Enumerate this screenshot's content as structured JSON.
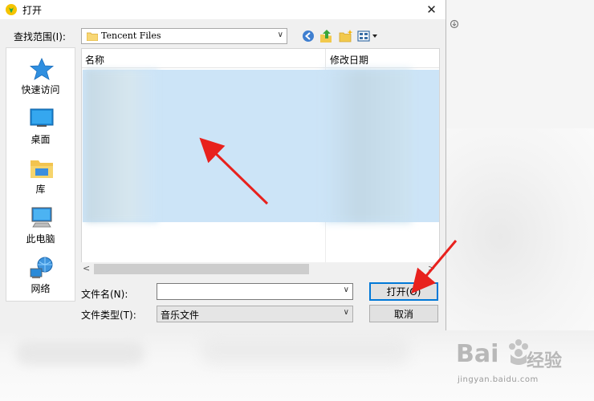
{
  "dialog": {
    "title": "打开",
    "close": "✕",
    "lookin_label": "查找范围(I):",
    "lookin_value": "Tencent Files",
    "icons": {
      "app": "app-logo-icon",
      "back": "back-icon",
      "up": "up-folder-icon",
      "new_folder": "new-folder-icon",
      "view": "view-menu-icon"
    }
  },
  "places": [
    {
      "label": "快速访问",
      "icon": "quick-access-icon"
    },
    {
      "label": "桌面",
      "icon": "desktop-icon"
    },
    {
      "label": "库",
      "icon": "library-icon"
    },
    {
      "label": "此电脑",
      "icon": "this-pc-icon"
    },
    {
      "label": "网络",
      "icon": "network-icon"
    }
  ],
  "filelist": {
    "col_name": "名称",
    "col_date": "修改日期"
  },
  "form": {
    "filename_label": "文件名(N):",
    "filename_value": "",
    "filetype_label": "文件类型(T):",
    "filetype_value": "音乐文件",
    "open_label": "打开(O)",
    "cancel_label": "取消"
  },
  "watermark": {
    "brand": "Bai",
    "brand_suffix": "经验",
    "url": "jingyan.baidu.com"
  },
  "colors": {
    "selection": "#cce4f7",
    "accent": "#0078d7",
    "annotation": "#e8211d"
  }
}
